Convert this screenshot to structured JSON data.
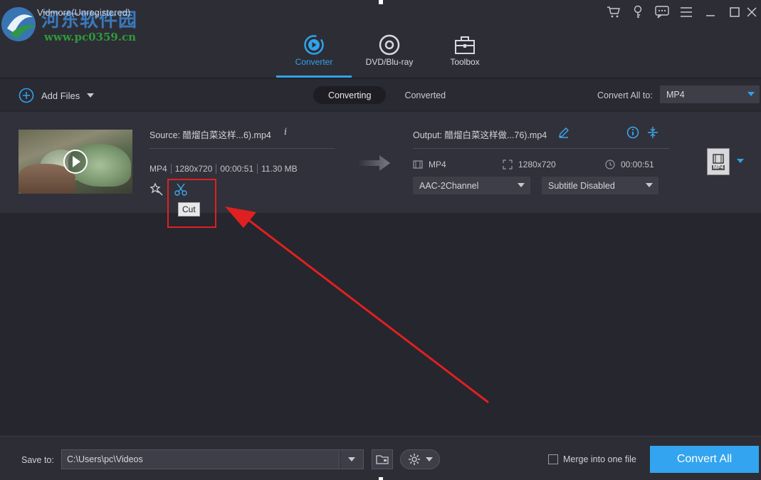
{
  "app": {
    "title": "Vidmore(Unregistered)",
    "watermark_text": "河东软件园",
    "watermark_url": "www.pc0359.cn"
  },
  "window_icons": [
    "cart-icon",
    "key-icon",
    "feedback-icon",
    "menu-icon",
    "minimize-icon",
    "maximize-icon",
    "close-icon"
  ],
  "main_tabs": [
    {
      "label": "Converter",
      "icon": "converter-icon",
      "active": true
    },
    {
      "label": "DVD/Blu-ray",
      "icon": "disc-icon",
      "active": false
    },
    {
      "label": "Toolbox",
      "icon": "toolbox-icon",
      "active": false
    }
  ],
  "toolbar": {
    "add_files_label": "Add Files",
    "tab_converting": "Converting",
    "tab_converted": "Converted",
    "convert_all_to_label": "Convert All to:",
    "convert_all_to_value": "MP4"
  },
  "file": {
    "source": "Source: 醋熘白菜这样...6).mp4",
    "meta": [
      "MP4",
      "1280x720",
      "00:00:51",
      "11.30 MB"
    ],
    "tooltip": "Cut",
    "output": "Output: 醋熘白菜这样做...76).mp4",
    "out_format": "MP4",
    "out_resolution": "1280x720",
    "out_duration": "00:00:51",
    "audio_track": "AAC-2Channel",
    "subtitle": "Subtitle Disabled",
    "format_badge": "MP4"
  },
  "bottom": {
    "save_to_label": "Save to:",
    "save_path": "C:\\Users\\pc\\Videos",
    "merge_label": "Merge into one file",
    "merge_checked": false,
    "convert_all_label": "Convert All"
  },
  "colors": {
    "accent": "#2fa3ea",
    "convert_button": "#33a4ef",
    "annotation": "#e02020"
  }
}
